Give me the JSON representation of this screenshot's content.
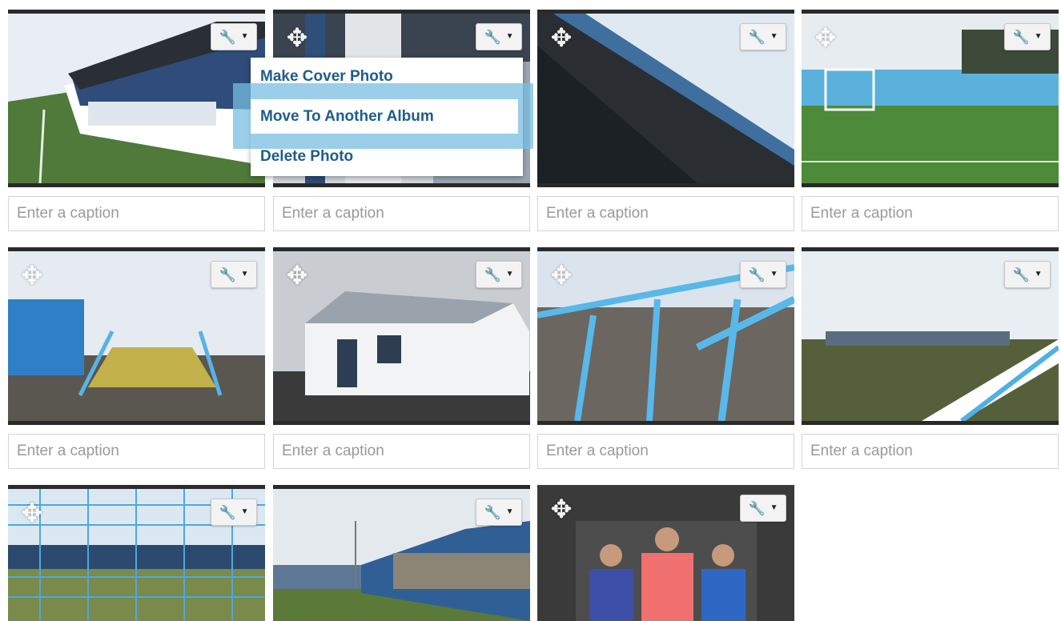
{
  "caption_placeholder": "Enter a caption",
  "menu": {
    "items": [
      "Make Cover Photo",
      "Move To Another Album",
      "Delete Photo"
    ],
    "active_index": 1,
    "text_color": "#1f5d8c",
    "highlight_color": "#78bee1"
  },
  "icons": {
    "tools": "wrench-icon",
    "caret": "caret-down-icon",
    "move": "move-arrows-icon"
  },
  "photos": [
    {
      "scene": "stadium stand"
    },
    {
      "scene": "stadium stand"
    },
    {
      "scene": "stand roof"
    },
    {
      "scene": "pitch and goal"
    },
    {
      "scene": "steps and containers"
    },
    {
      "scene": "white building"
    },
    {
      "scene": "blue railings"
    },
    {
      "scene": "pitch view"
    },
    {
      "scene": "goal net view"
    },
    {
      "scene": "stadium stand"
    },
    {
      "scene": "team players"
    }
  ]
}
